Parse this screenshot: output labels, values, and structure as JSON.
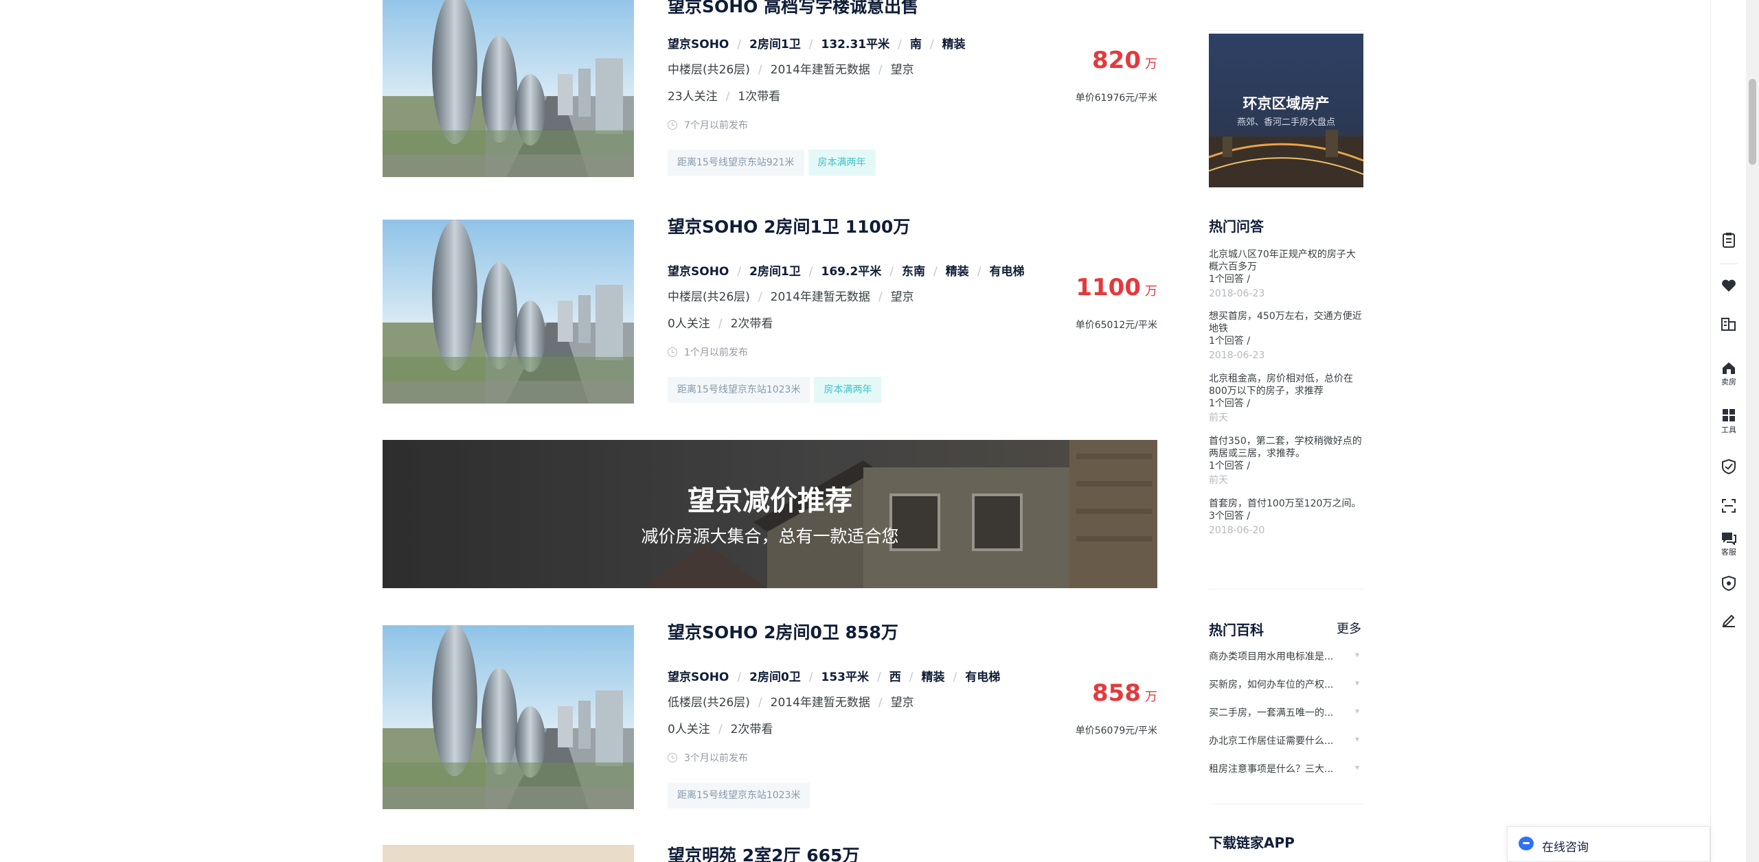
{
  "listings": [
    {
      "title": "望京SOHO 高档写字楼诚意出售",
      "attrs": [
        "望京SOHO",
        "2房间1卫",
        "132.31平米",
        "南",
        "精装"
      ],
      "meta": [
        "中楼层(共26层)",
        "2014年建暂无数据",
        "望京"
      ],
      "follow": [
        "23人关注",
        "1次带看"
      ],
      "time": "7个月以前发布",
      "tags": [
        "距离15号线望京东站921米",
        "房本满两年"
      ],
      "price": "820",
      "price_unit": "万",
      "unit_price": "单价61976元/平米"
    },
    {
      "title": "望京SOHO 2房间1卫 1100万",
      "attrs": [
        "望京SOHO",
        "2房间1卫",
        "169.2平米",
        "东南",
        "精装",
        "有电梯"
      ],
      "meta": [
        "中楼层(共26层)",
        "2014年建暂无数据",
        "望京"
      ],
      "follow": [
        "0人关注",
        "2次带看"
      ],
      "time": "1个月以前发布",
      "tags": [
        "距离15号线望京东站1023米",
        "房本满两年"
      ],
      "price": "1100",
      "price_unit": "万",
      "unit_price": "单价65012元/平米"
    },
    {
      "title": "望京SOHO 2房间0卫 858万",
      "attrs": [
        "望京SOHO",
        "2房间0卫",
        "153平米",
        "西",
        "精装",
        "有电梯"
      ],
      "meta": [
        "低楼层(共26层)",
        "2014年建暂无数据",
        "望京"
      ],
      "follow": [
        "0人关注",
        "2次带看"
      ],
      "time": "3个月以前发布",
      "tags": [
        "距离15号线望京东站1023米"
      ],
      "price": "858",
      "price_unit": "万",
      "unit_price": "单价56079元/平米"
    },
    {
      "title": "望京明苑 2室2厅 665万"
    }
  ],
  "banner": {
    "title": "望京减价推荐",
    "subtitle": "减价房源大集合，总有一款适合您"
  },
  "side": {
    "ad_title": "环京区域房产",
    "ad_subtitle": "燕郊、香河二手房大盘点",
    "qa_heading": "热门问答",
    "qa": [
      {
        "q": "北京城八区70年正规产权的房子大概六百多万",
        "count": "1个回答 /",
        "date": "2018-06-23"
      },
      {
        "q": "想买首房，450万左右，交通方便近地铁",
        "count": "1个回答 /",
        "date": "2018-06-23"
      },
      {
        "q": "北京租金高，房价相对低，总价在800万以下的房子，求推荐",
        "count": "1个回答 /",
        "date": "前天"
      },
      {
        "q": "首付350，第二套，学校稍微好点的两居或三居，求推荐。",
        "count": "1个回答 /",
        "date": "前天"
      },
      {
        "q": "首套房，首付100万至120万之间。",
        "count": "3个回答 /",
        "date": "2018-06-20"
      }
    ],
    "wiki_heading": "热门百科",
    "wiki_more": "更多",
    "wiki": [
      "商办类项目用水用电标准是...",
      "买新房，如何办车位的产权...",
      "买二手房，一套满五唯一的...",
      "办北京工作居住证需要什么...",
      "租房注意事项是什么？三大..."
    ],
    "app_heading": "下载链家APP"
  },
  "toolbar": {
    "sell_label": "卖房",
    "tools_label": "工具",
    "service_label": "客服"
  },
  "consult": {
    "label": "在线咨询"
  },
  "colors": {
    "price_red": "#e4393c",
    "title_dark": "#101d37",
    "tag_teal": "#3ec3c8",
    "accent_blue": "#3072f6"
  },
  "icons": [
    "clock-icon",
    "clipboard-icon",
    "heart-icon",
    "compare-icon",
    "sell-house-icon",
    "tools-grid-icon",
    "shield-icon",
    "scan-icon",
    "chat-icon",
    "security-check-icon",
    "edit-icon",
    "consult-chat-icon",
    "chevron-down-icon"
  ]
}
